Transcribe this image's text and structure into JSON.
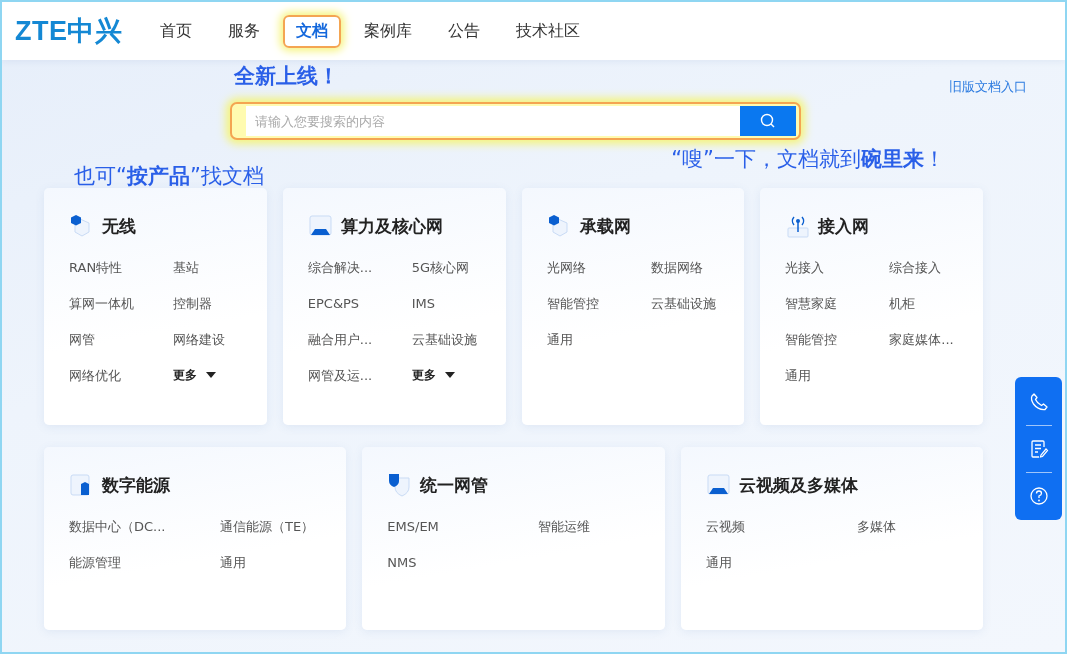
{
  "header": {
    "logo": "ZTE中兴",
    "nav": [
      {
        "label": "首页",
        "selected": false
      },
      {
        "label": "服务",
        "selected": false
      },
      {
        "label": "文档",
        "selected": true
      },
      {
        "label": "案例库",
        "selected": false
      },
      {
        "label": "公告",
        "selected": false
      },
      {
        "label": "技术社区",
        "selected": false
      }
    ]
  },
  "hero": {
    "headline": "全新上线！",
    "old_version_link": "旧版文档入口",
    "search": {
      "placeholder": "请输入您要搜索的内容"
    },
    "hint_left": "也可“**按产品**”找文档",
    "hint_right": "“嗖”一下，文档就到**碗里来**！"
  },
  "category_rows": [
    {
      "cards": [
        {
          "title": "无线",
          "items": [
            {
              "label": "RAN特性",
              "kind": "link"
            },
            {
              "label": "基站",
              "kind": "link"
            },
            {
              "label": "算网一体机",
              "kind": "link"
            },
            {
              "label": "控制器",
              "kind": "link"
            },
            {
              "label": "网管",
              "kind": "link"
            },
            {
              "label": "网络建设",
              "kind": "link"
            },
            {
              "label": "网络优化",
              "kind": "link"
            },
            {
              "label": "更多",
              "kind": "more"
            }
          ]
        },
        {
          "title": "算力及核心网",
          "items": [
            {
              "label": "综合解决...",
              "kind": "link"
            },
            {
              "label": "5G核心网",
              "kind": "link"
            },
            {
              "label": "EPC&PS",
              "kind": "link"
            },
            {
              "label": "IMS",
              "kind": "link"
            },
            {
              "label": "融合用户...",
              "kind": "link"
            },
            {
              "label": "云基础设施",
              "kind": "link"
            },
            {
              "label": "网管及运...",
              "kind": "link"
            },
            {
              "label": "更多",
              "kind": "more"
            }
          ]
        },
        {
          "title": "承载网",
          "items": [
            {
              "label": "光网络",
              "kind": "link"
            },
            {
              "label": "数据网络",
              "kind": "link"
            },
            {
              "label": "智能管控",
              "kind": "link"
            },
            {
              "label": "云基础设施",
              "kind": "link"
            },
            {
              "label": "通用",
              "kind": "link"
            }
          ]
        },
        {
          "title": "接入网",
          "items": [
            {
              "label": "光接入",
              "kind": "link"
            },
            {
              "label": "综合接入",
              "kind": "link"
            },
            {
              "label": "智慧家庭",
              "kind": "link"
            },
            {
              "label": "机柜",
              "kind": "link"
            },
            {
              "label": "智能管控",
              "kind": "link"
            },
            {
              "label": "家庭媒体...",
              "kind": "link"
            },
            {
              "label": "通用",
              "kind": "link"
            }
          ]
        }
      ]
    },
    {
      "cards": [
        {
          "title": "数字能源",
          "items": [
            {
              "label": "数据中心（DC...",
              "kind": "link"
            },
            {
              "label": "通信能源（TE）",
              "kind": "link"
            },
            {
              "label": "能源管理",
              "kind": "link"
            },
            {
              "label": "通用",
              "kind": "link"
            }
          ]
        },
        {
          "title": "统一网管",
          "items": [
            {
              "label": "EMS/EM",
              "kind": "link"
            },
            {
              "label": "智能运维",
              "kind": "link"
            },
            {
              "label": "NMS",
              "kind": "link"
            }
          ]
        },
        {
          "title": "云视频及多媒体",
          "items": [
            {
              "label": "云视频",
              "kind": "link"
            },
            {
              "label": "多媒体",
              "kind": "link"
            },
            {
              "label": "通用",
              "kind": "link"
            }
          ]
        }
      ]
    }
  ]
}
